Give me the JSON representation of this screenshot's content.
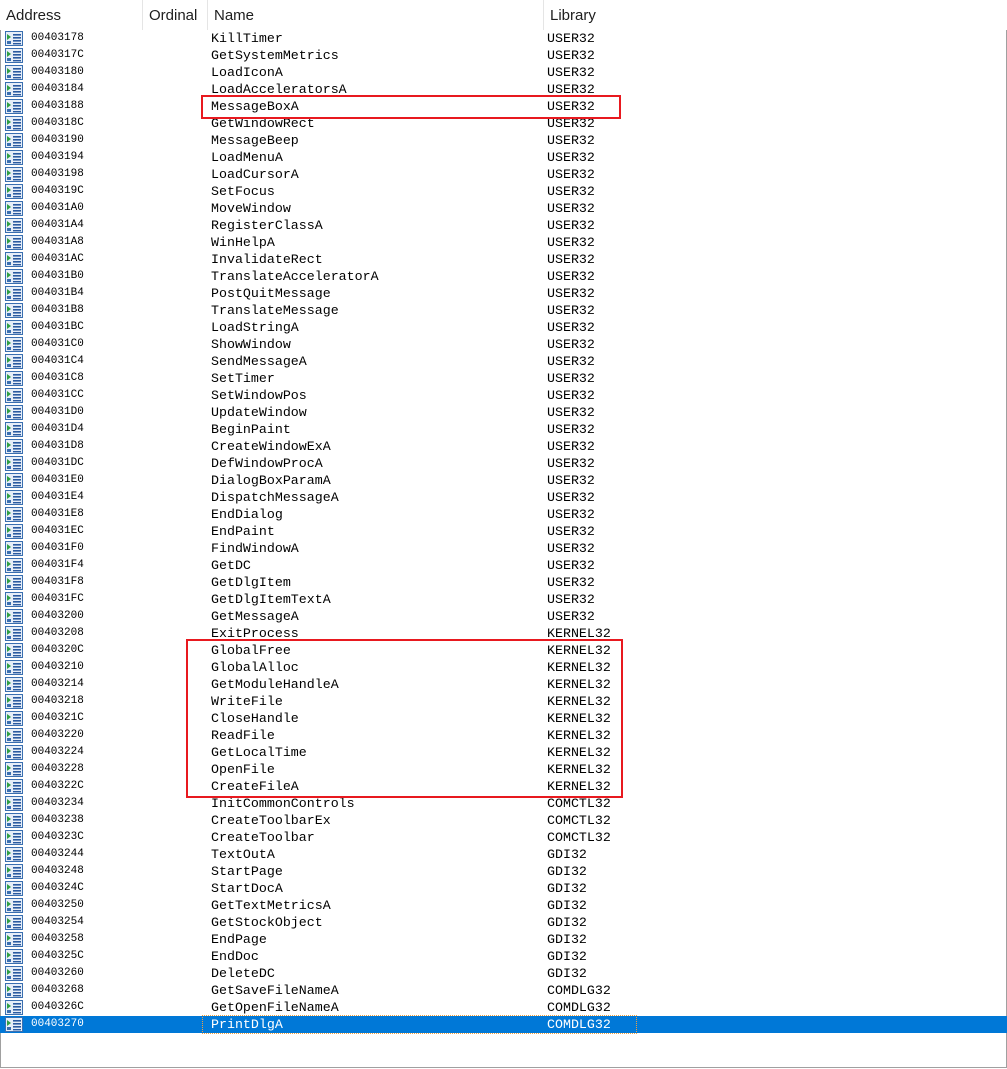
{
  "columns": {
    "address": "Address",
    "ordinal": "Ordinal",
    "name": "Name",
    "library": "Library"
  },
  "colors": {
    "selection": "#0078d7",
    "highlight": "#e8191f"
  },
  "selected_index": 58,
  "rows": [
    {
      "address": "00403178",
      "name": "KillTimer",
      "library": "USER32"
    },
    {
      "address": "0040317C",
      "name": "GetSystemMetrics",
      "library": "USER32"
    },
    {
      "address": "00403180",
      "name": "LoadIconA",
      "library": "USER32"
    },
    {
      "address": "00403184",
      "name": "LoadAcceleratorsA",
      "library": "USER32"
    },
    {
      "address": "00403188",
      "name": "MessageBoxA",
      "library": "USER32"
    },
    {
      "address": "0040318C",
      "name": "GetWindowRect",
      "library": "USER32"
    },
    {
      "address": "00403190",
      "name": "MessageBeep",
      "library": "USER32"
    },
    {
      "address": "00403194",
      "name": "LoadMenuA",
      "library": "USER32"
    },
    {
      "address": "00403198",
      "name": "LoadCursorA",
      "library": "USER32"
    },
    {
      "address": "0040319C",
      "name": "SetFocus",
      "library": "USER32"
    },
    {
      "address": "004031A0",
      "name": "MoveWindow",
      "library": "USER32"
    },
    {
      "address": "004031A4",
      "name": "RegisterClassA",
      "library": "USER32"
    },
    {
      "address": "004031A8",
      "name": "WinHelpA",
      "library": "USER32"
    },
    {
      "address": "004031AC",
      "name": "InvalidateRect",
      "library": "USER32"
    },
    {
      "address": "004031B0",
      "name": "TranslateAcceleratorA",
      "library": "USER32"
    },
    {
      "address": "004031B4",
      "name": "PostQuitMessage",
      "library": "USER32"
    },
    {
      "address": "004031B8",
      "name": "TranslateMessage",
      "library": "USER32"
    },
    {
      "address": "004031BC",
      "name": "LoadStringA",
      "library": "USER32"
    },
    {
      "address": "004031C0",
      "name": "ShowWindow",
      "library": "USER32"
    },
    {
      "address": "004031C4",
      "name": "SendMessageA",
      "library": "USER32"
    },
    {
      "address": "004031C8",
      "name": "SetTimer",
      "library": "USER32"
    },
    {
      "address": "004031CC",
      "name": "SetWindowPos",
      "library": "USER32"
    },
    {
      "address": "004031D0",
      "name": "UpdateWindow",
      "library": "USER32"
    },
    {
      "address": "004031D4",
      "name": "BeginPaint",
      "library": "USER32"
    },
    {
      "address": "004031D8",
      "name": "CreateWindowExA",
      "library": "USER32"
    },
    {
      "address": "004031DC",
      "name": "DefWindowProcA",
      "library": "USER32"
    },
    {
      "address": "004031E0",
      "name": "DialogBoxParamA",
      "library": "USER32"
    },
    {
      "address": "004031E4",
      "name": "DispatchMessageA",
      "library": "USER32"
    },
    {
      "address": "004031E8",
      "name": "EndDialog",
      "library": "USER32"
    },
    {
      "address": "004031EC",
      "name": "EndPaint",
      "library": "USER32"
    },
    {
      "address": "004031F0",
      "name": "FindWindowA",
      "library": "USER32"
    },
    {
      "address": "004031F4",
      "name": "GetDC",
      "library": "USER32"
    },
    {
      "address": "004031F8",
      "name": "GetDlgItem",
      "library": "USER32"
    },
    {
      "address": "004031FC",
      "name": "GetDlgItemTextA",
      "library": "USER32"
    },
    {
      "address": "00403200",
      "name": "GetMessageA",
      "library": "USER32"
    },
    {
      "address": "00403208",
      "name": "ExitProcess",
      "library": "KERNEL32"
    },
    {
      "address": "0040320C",
      "name": "GlobalFree",
      "library": "KERNEL32"
    },
    {
      "address": "00403210",
      "name": "GlobalAlloc",
      "library": "KERNEL32"
    },
    {
      "address": "00403214",
      "name": "GetModuleHandleA",
      "library": "KERNEL32"
    },
    {
      "address": "00403218",
      "name": "WriteFile",
      "library": "KERNEL32"
    },
    {
      "address": "0040321C",
      "name": "CloseHandle",
      "library": "KERNEL32"
    },
    {
      "address": "00403220",
      "name": "ReadFile",
      "library": "KERNEL32"
    },
    {
      "address": "00403224",
      "name": "GetLocalTime",
      "library": "KERNEL32"
    },
    {
      "address": "00403228",
      "name": "OpenFile",
      "library": "KERNEL32"
    },
    {
      "address": "0040322C",
      "name": "CreateFileA",
      "library": "KERNEL32"
    },
    {
      "address": "00403234",
      "name": "InitCommonControls",
      "library": "COMCTL32"
    },
    {
      "address": "00403238",
      "name": "CreateToolbarEx",
      "library": "COMCTL32"
    },
    {
      "address": "0040323C",
      "name": "CreateToolbar",
      "library": "COMCTL32"
    },
    {
      "address": "00403244",
      "name": "TextOutA",
      "library": "GDI32"
    },
    {
      "address": "00403248",
      "name": "StartPage",
      "library": "GDI32"
    },
    {
      "address": "0040324C",
      "name": "StartDocA",
      "library": "GDI32"
    },
    {
      "address": "00403250",
      "name": "GetTextMetricsA",
      "library": "GDI32"
    },
    {
      "address": "00403254",
      "name": "GetStockObject",
      "library": "GDI32"
    },
    {
      "address": "00403258",
      "name": "EndPage",
      "library": "GDI32"
    },
    {
      "address": "0040325C",
      "name": "EndDoc",
      "library": "GDI32"
    },
    {
      "address": "00403260",
      "name": "DeleteDC",
      "library": "GDI32"
    },
    {
      "address": "00403268",
      "name": "GetSaveFileNameA",
      "library": "COMDLG32"
    },
    {
      "address": "0040326C",
      "name": "GetOpenFileNameA",
      "library": "COMDLG32"
    },
    {
      "address": "00403270",
      "name": "PrintDlgA",
      "library": "COMDLG32"
    }
  ]
}
